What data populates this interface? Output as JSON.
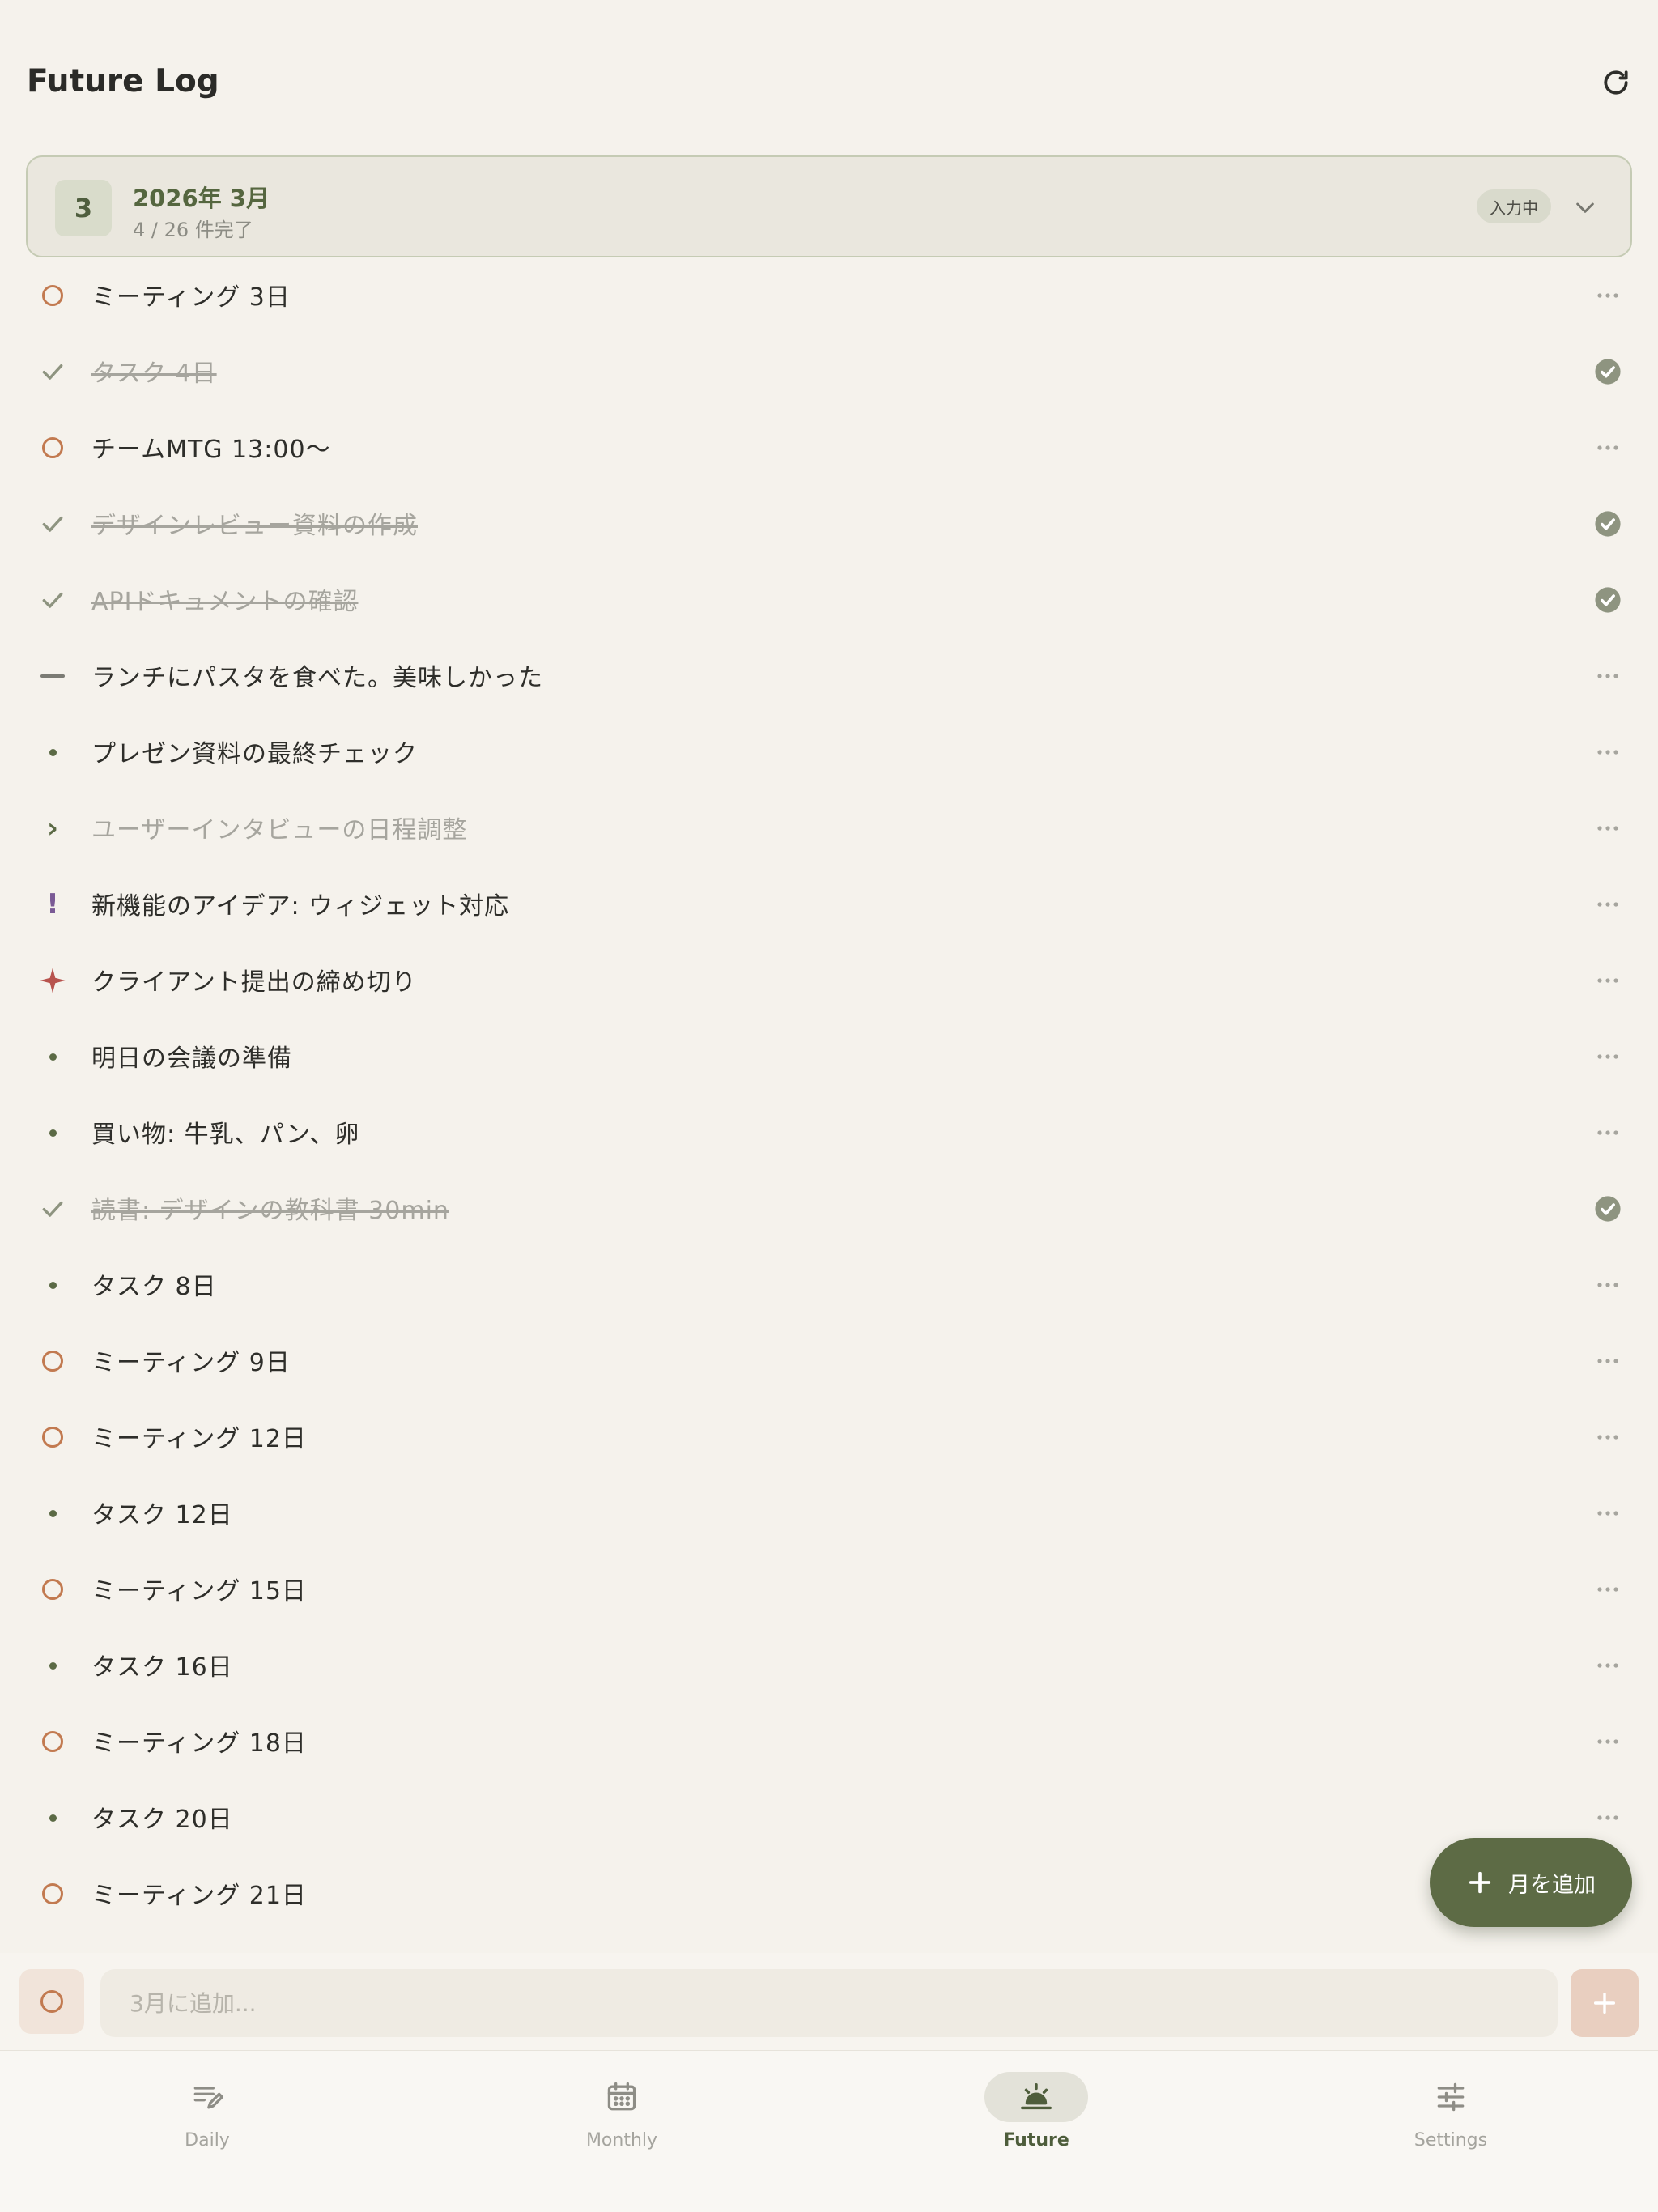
{
  "header": {
    "title": "Future Log"
  },
  "month": {
    "number": "3",
    "title": "2026年 3月",
    "progress": "4 / 26 件完了",
    "status": "入力中"
  },
  "entries": [
    {
      "type": "event",
      "text": "ミーティング 3日"
    },
    {
      "type": "done",
      "text": "タスク 4日"
    },
    {
      "type": "event",
      "text": "チームMTG 13:00〜"
    },
    {
      "type": "done",
      "text": "デザインレビュー資料の作成"
    },
    {
      "type": "done",
      "text": "APIドキュメントの確認"
    },
    {
      "type": "note",
      "text": "ランチにパスタを食べた。美味しかった"
    },
    {
      "type": "task",
      "text": "プレゼン資料の最終チェック"
    },
    {
      "type": "migrated",
      "text": "ユーザーインタビューの日程調整"
    },
    {
      "type": "idea",
      "text": "新機能のアイデア: ウィジェット対応"
    },
    {
      "type": "priority",
      "text": "クライアント提出の締め切り"
    },
    {
      "type": "task",
      "text": "明日の会議の準備"
    },
    {
      "type": "task",
      "text": "買い物: 牛乳、パン、卵"
    },
    {
      "type": "done",
      "text": "読書: デザインの教科書 30min"
    },
    {
      "type": "task",
      "text": "タスク 8日"
    },
    {
      "type": "event",
      "text": "ミーティング 9日"
    },
    {
      "type": "event",
      "text": "ミーティング 12日"
    },
    {
      "type": "task",
      "text": "タスク 12日"
    },
    {
      "type": "event",
      "text": "ミーティング 15日"
    },
    {
      "type": "task",
      "text": "タスク 16日"
    },
    {
      "type": "event",
      "text": "ミーティング 18日"
    },
    {
      "type": "task",
      "text": "タスク 20日"
    },
    {
      "type": "event",
      "text": "ミーティング 21日"
    }
  ],
  "fab": {
    "label": "月を追加"
  },
  "input": {
    "placeholder": "3月に追加..."
  },
  "nav": {
    "items": [
      {
        "label": "Daily",
        "icon": "daily-edit-icon"
      },
      {
        "label": "Monthly",
        "icon": "calendar-icon"
      },
      {
        "label": "Future",
        "icon": "sunrise-icon",
        "active": true
      },
      {
        "label": "Settings",
        "icon": "sliders-icon"
      }
    ]
  },
  "colors": {
    "accent": "#5d6b45",
    "event": "#c27a50",
    "idea": "#7a5a95",
    "priority": "#b8534d",
    "done": "#8e9480",
    "background": "#f5f2ec"
  }
}
